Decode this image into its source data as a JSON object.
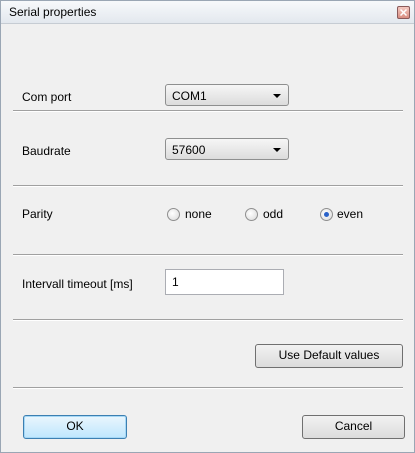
{
  "window": {
    "title": "Serial properties"
  },
  "fields": {
    "com_port": {
      "label": "Com port",
      "value": "COM1"
    },
    "baudrate": {
      "label": "Baudrate",
      "value": "57600"
    },
    "parity": {
      "label": "Parity",
      "options": [
        "none",
        "odd",
        "even"
      ],
      "selected": "even"
    },
    "timeout": {
      "label": "Intervall timeout [ms]",
      "value": "1"
    }
  },
  "buttons": {
    "default_values": "Use Default values",
    "ok": "OK",
    "cancel": "Cancel"
  },
  "icons": {
    "close": "close-icon",
    "dropdown": "chevron-down-icon"
  }
}
